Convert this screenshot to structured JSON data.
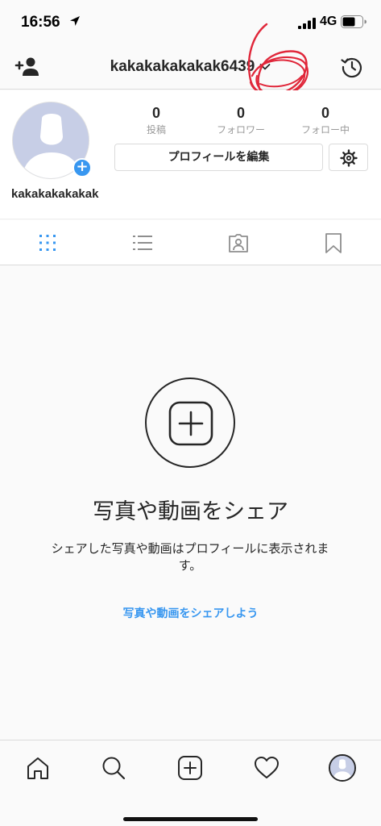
{
  "status_bar": {
    "time": "16:56",
    "network": "4G",
    "icons": [
      "location-arrow-icon",
      "signal-icon",
      "battery-icon"
    ]
  },
  "header": {
    "username": "kakakakakakak6439",
    "icons": [
      "add-user-icon",
      "chevron-down-icon",
      "history-icon"
    ],
    "annotation": "6"
  },
  "profile": {
    "display_name": "kakakakakakak",
    "stats": [
      {
        "value": "0",
        "label": "投稿"
      },
      {
        "value": "0",
        "label": "フォロワー"
      },
      {
        "value": "0",
        "label": "フォロー中"
      }
    ],
    "edit_label": "プロフィールを編集",
    "avatar_plus": "+"
  },
  "tabs": {
    "items": [
      "grid-icon",
      "list-icon",
      "tagged-icon",
      "saved-icon"
    ],
    "active_index": 0
  },
  "empty_state": {
    "title": "写真や動画をシェア",
    "description": "シェアした写真や動画はプロフィールに表示されます。",
    "link": "写真や動画をシェアしよう"
  },
  "bottom_nav": {
    "items": [
      "home-icon",
      "search-icon",
      "new-post-icon",
      "activity-heart-icon",
      "profile-avatar"
    ]
  },
  "colors": {
    "accent": "#3897f0",
    "text": "#262626",
    "muted": "#999999",
    "border": "#dbdbdb",
    "annotation": "#e0273a"
  }
}
